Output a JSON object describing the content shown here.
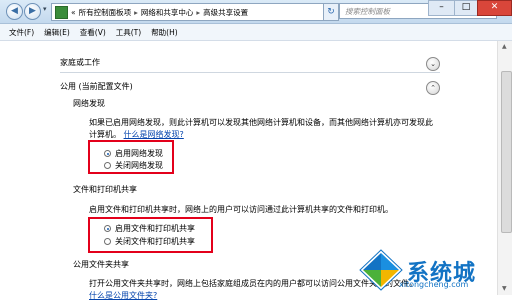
{
  "titlebar": {
    "back_icon": "back-arrow-icon",
    "forward_icon": "forward-arrow-icon",
    "breadcrumb": [
      "«",
      "所有控制面板项",
      "网络和共享中心",
      "高级共享设置"
    ],
    "search_placeholder": "搜索控制面板",
    "window_controls": [
      "minimize-icon",
      "maximize-icon",
      "close-icon"
    ]
  },
  "menu": [
    "文件(F)",
    "编辑(E)",
    "查看(V)",
    "工具(T)",
    "帮助(H)"
  ],
  "sections": {
    "home_work": "家庭或工作",
    "public": "公用 (当前配置文件)"
  },
  "network_discovery": {
    "heading": "网络发现",
    "desc_line1": "如果已启用网络发现，则此计算机可以发现其他网络计算机和设备，而其他网络计算机亦可发现此",
    "desc_line2": "计算机。",
    "link": "什么是网络发现?",
    "opt_on": "启用网络发现",
    "opt_off": "关闭网络发现",
    "selected": "启用网络发现"
  },
  "file_sharing": {
    "heading": "文件和打印机共享",
    "desc": "启用文件和打印机共享时，网络上的用户可以访问通过此计算机共享的文件和打印机。",
    "opt_on": "启用文件和打印机共享",
    "opt_off": "关闭文件和打印机共享",
    "selected": "启用文件和打印机共享"
  },
  "public_folder": {
    "heading": "公用文件夹共享",
    "desc": "打开公用文件夹共享时，网络上包括家庭组成员在内的用户都可以访问公用文件夹中的文件。",
    "link": "什么是公用文件夹?"
  },
  "colors": {
    "highlight_box": "#e3001b",
    "link": "#0645ad",
    "watermark": "#1273c4"
  },
  "watermark": {
    "text": "系统城",
    "url": "xitongcheng.com"
  }
}
